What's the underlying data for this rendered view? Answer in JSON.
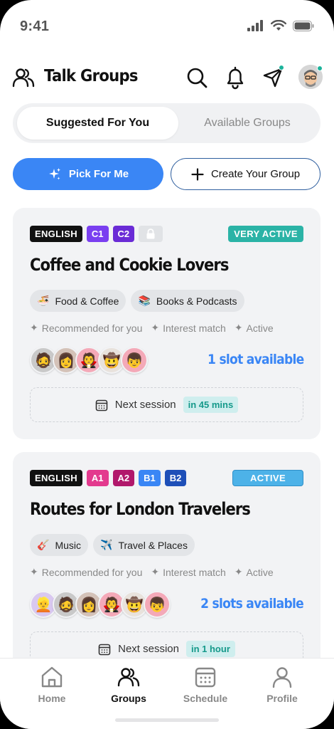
{
  "status_bar": {
    "time": "9:41"
  },
  "header": {
    "title": "Talk Groups",
    "icons": [
      "people-icon",
      "search-icon",
      "bell-icon",
      "send-icon",
      "profile-avatar"
    ]
  },
  "tabs": [
    {
      "label": "Suggested For You",
      "active": true
    },
    {
      "label": "Available Groups",
      "active": false
    }
  ],
  "actions": {
    "pick_label": "Pick For Me",
    "create_label": "Create Your Group"
  },
  "cards": [
    {
      "language": "ENGLISH",
      "levels": [
        {
          "label": "C1",
          "color": "#7a3ff0"
        },
        {
          "label": "C2",
          "color": "#6a2bd6"
        }
      ],
      "locked": true,
      "activity": "VERY ACTIVE",
      "activity_color": "#2bb3a6",
      "title": "Coffee and Cookie Lovers",
      "chips": [
        {
          "emoji": "🍜",
          "label": "Food & Coffee"
        },
        {
          "emoji": "📚",
          "label": "Books & Podcasts"
        }
      ],
      "reasons": [
        "Recommended for you",
        "Interest match",
        "Active"
      ],
      "avatars": [
        {
          "emoji": "🧔",
          "bg": "#c9c9c9"
        },
        {
          "emoji": "👩",
          "bg": "#d4c2b8"
        },
        {
          "emoji": "🧛",
          "bg": "#f4a9b8"
        },
        {
          "emoji": "🤠",
          "bg": "#e8e2dc"
        },
        {
          "emoji": "👦",
          "bg": "#f4a9b8"
        }
      ],
      "slots": "1 slot available",
      "session_label": "Next session",
      "session_time": "in 45 mins"
    },
    {
      "language": "ENGLISH",
      "levels": [
        {
          "label": "A1",
          "color": "#e33a8e"
        },
        {
          "label": "A2",
          "color": "#b1186b"
        },
        {
          "label": "B1",
          "color": "#3a86f5"
        },
        {
          "label": "B2",
          "color": "#1e4fb8"
        }
      ],
      "locked": false,
      "activity": "ACTIVE",
      "activity_color": "#4db2e8",
      "title": "Routes for London Travelers",
      "chips": [
        {
          "emoji": "🎸",
          "label": "Music"
        },
        {
          "emoji": "✈️",
          "label": "Travel & Places"
        }
      ],
      "reasons": [
        "Recommended for you",
        "Interest match",
        "Active"
      ],
      "avatars": [
        {
          "emoji": "👱",
          "bg": "#d9c8f0"
        },
        {
          "emoji": "🧔",
          "bg": "#c9c9c9"
        },
        {
          "emoji": "👩",
          "bg": "#d4c2b8"
        },
        {
          "emoji": "🧛",
          "bg": "#f4a9b8"
        },
        {
          "emoji": "🤠",
          "bg": "#e8e2dc"
        },
        {
          "emoji": "👦",
          "bg": "#f4a9b8"
        }
      ],
      "slots": "2 slots available",
      "session_label": "Next session",
      "session_time": "in 1 hour"
    }
  ],
  "bottom_nav": [
    {
      "label": "Home",
      "icon": "home-icon",
      "active": false
    },
    {
      "label": "Groups",
      "icon": "groups-icon",
      "active": true
    },
    {
      "label": "Schedule",
      "icon": "calendar-icon",
      "active": false
    },
    {
      "label": "Profile",
      "icon": "profile-icon",
      "active": false
    }
  ]
}
